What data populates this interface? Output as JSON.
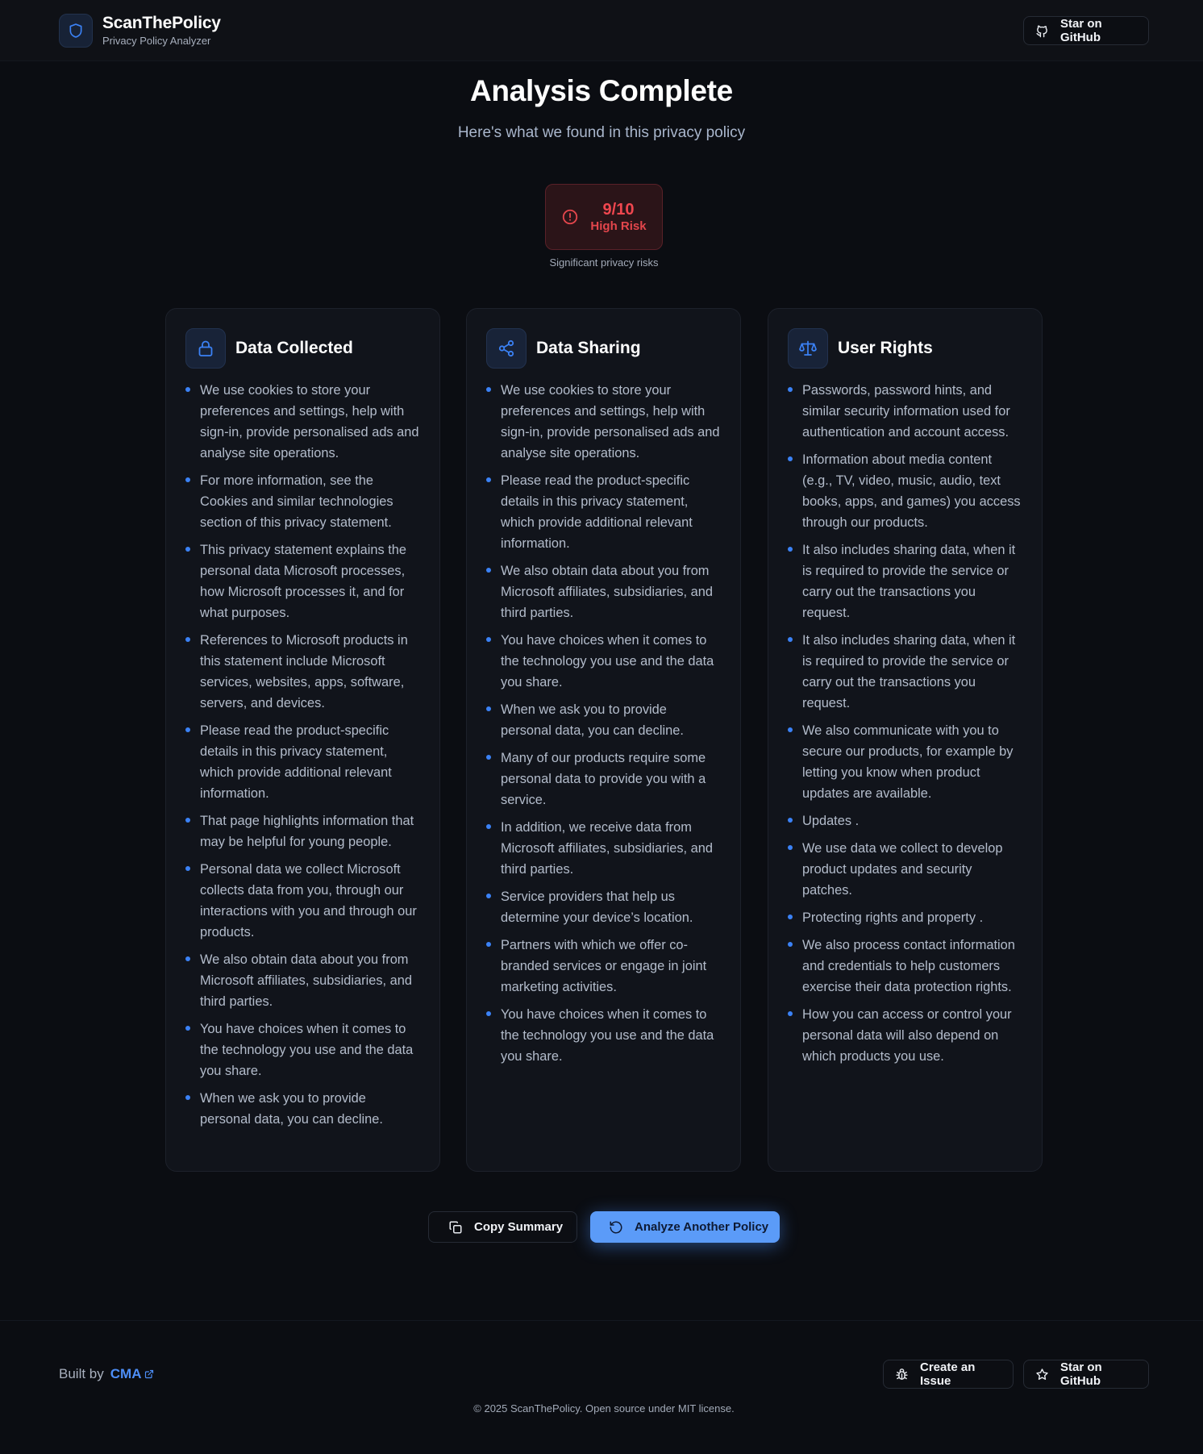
{
  "header": {
    "brand_name": "ScanThePolicy",
    "brand_sub": "Privacy Policy Analyzer",
    "github_label": "Star on GitHub"
  },
  "hero": {
    "title": "Analysis Complete",
    "subtitle": "Here's what we found in this privacy policy"
  },
  "risk": {
    "score": "9/10",
    "label": "High Risk",
    "caption": "Significant privacy risks",
    "color": "#f0474f"
  },
  "cards": [
    {
      "title": "Data Collected",
      "icon": "lock-icon",
      "items": [
        "We use cookies to store your preferences and settings, help with sign-in, provide personalised ads and analyse site operations.",
        "For more information, see the Cookies and similar technologies section of this privacy statement.",
        "This privacy statement explains the personal data Microsoft processes, how Microsoft processes it, and for what purposes.",
        "References to Microsoft products in this statement include Microsoft services, websites, apps, software, servers, and devices.",
        "Please read the product-specific details in this privacy statement, which provide additional relevant information.",
        "That page highlights information that may be helpful for young people.",
        "Personal data we collect Microsoft collects data from you, through our interactions with you and through our products.",
        "We also obtain data about you from Microsoft affiliates, subsidiaries, and third parties.",
        "You have choices when it comes to the technology you use and the data you share.",
        "When we ask you to provide personal data, you can decline."
      ]
    },
    {
      "title": "Data Sharing",
      "icon": "share-icon",
      "items": [
        "We use cookies to store your preferences and settings, help with sign-in, provide personalised ads and analyse site operations.",
        "Please read the product-specific details in this privacy statement, which provide additional relevant information.",
        "We also obtain data about you from Microsoft affiliates, subsidiaries, and third parties.",
        "You have choices when it comes to the technology you use and the data you share.",
        "When we ask you to provide personal data, you can decline.",
        "Many of our products require some personal data to provide you with a service.",
        "In addition, we receive data from Microsoft affiliates, subsidiaries, and third parties.",
        "Service providers that help us determine your device’s location.",
        "Partners with which we offer co-branded services or engage in joint marketing activities.",
        "You have choices when it comes to the technology you use and the data you share."
      ]
    },
    {
      "title": "User Rights",
      "icon": "scale-icon",
      "items": [
        "Passwords, password hints, and similar security information used for authentication and account access.",
        "Information about media content (e.g., TV, video, music, audio, text books, apps, and games) you access through our products.",
        "It also includes sharing data, when it is required to provide the service or carry out the transactions you request.",
        "It also includes sharing data, when it is required to provide the service or carry out the transactions you request.",
        "We also communicate with you to secure our products, for example by letting you know when product updates are available.",
        "Updates .",
        "We use data we collect to develop product updates and security patches.",
        "Protecting rights and property .",
        "We also process contact information and credentials to help customers exercise their data protection rights.",
        "How you can access or control your personal data will also depend on which products you use."
      ]
    }
  ],
  "actions": {
    "copy_label": "Copy Summary",
    "analyze_label": "Analyze Another Policy"
  },
  "footer": {
    "built_by": "Built by",
    "author": "CMA",
    "issue_label": "Create an Issue",
    "github_label": "Star on GitHub",
    "copyright": "© 2025 ScanThePolicy. Open source under MIT license."
  },
  "colors": {
    "accent": "#3b82f6",
    "background": "#0b0d12",
    "danger": "#f0474f"
  }
}
